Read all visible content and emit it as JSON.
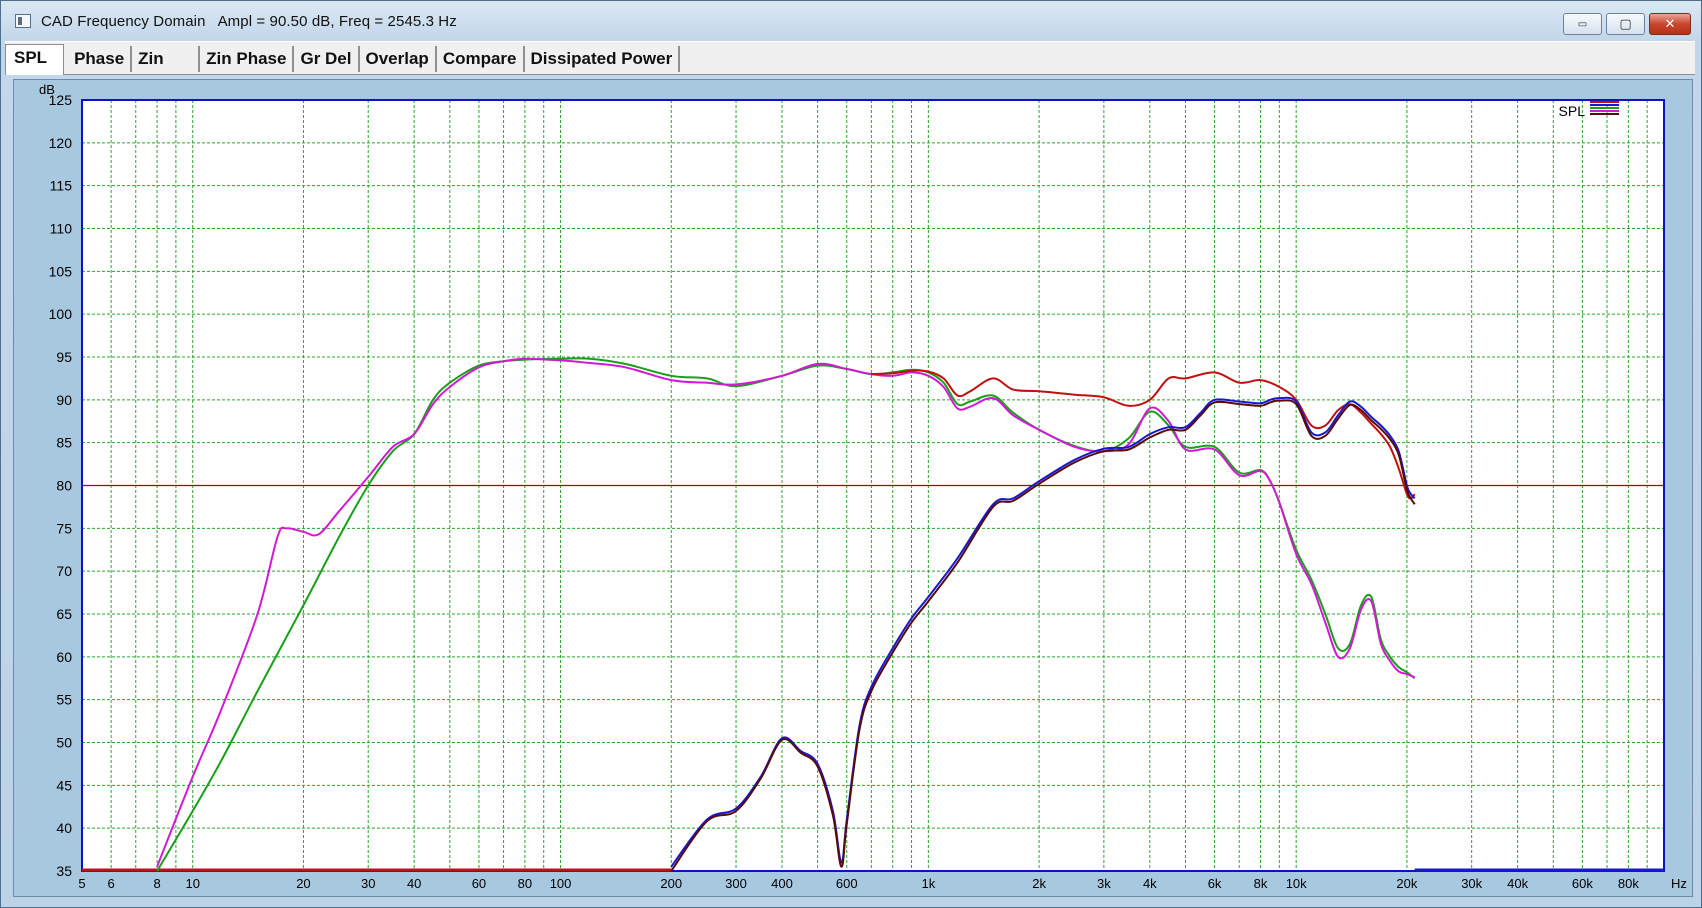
{
  "window": {
    "title": "CAD Frequency Domain",
    "readout": "Ampl = 90.50 dB, Freq = 2545.3 Hz",
    "buttons": {
      "minimize": "▭",
      "maximize": "▢",
      "close": "✕"
    }
  },
  "tabs": [
    "SPL",
    "Phase",
    "Zin",
    "Zin Phase",
    "Gr Del",
    "Overlap",
    "Compare",
    "Dissipated Power"
  ],
  "active_tab": "SPL",
  "colors": {
    "grid": "#2aa52a",
    "axis_frame": "#1010c8",
    "reference_line": "#b00000",
    "plot_background": "#ffffff",
    "series_green": "#18a018",
    "series_magenta": "#d21ad2",
    "series_red": "#c01010",
    "series_blue": "#1818d0",
    "series_dark": "#5a0a0a"
  },
  "chart_data": {
    "type": "line",
    "xscale": "log",
    "xlim": [
      5,
      100000
    ],
    "ylim": [
      35,
      125
    ],
    "ylabel": "dB",
    "xlabel": "Hz",
    "legend_label": "SPL",
    "legend_position": "top-right",
    "grid": true,
    "reference_line_y": 80,
    "yticks": [
      35,
      40,
      45,
      50,
      55,
      60,
      65,
      70,
      75,
      80,
      85,
      90,
      95,
      100,
      105,
      110,
      115,
      120,
      125
    ],
    "xtick_labels": [
      {
        "f": 5,
        "label": "5"
      },
      {
        "f": 6,
        "label": "6"
      },
      {
        "f": 8,
        "label": "8"
      },
      {
        "f": 10,
        "label": "10"
      },
      {
        "f": 20,
        "label": "20"
      },
      {
        "f": 30,
        "label": "30"
      },
      {
        "f": 40,
        "label": "40"
      },
      {
        "f": 60,
        "label": "60"
      },
      {
        "f": 80,
        "label": "80"
      },
      {
        "f": 100,
        "label": "100"
      },
      {
        "f": 200,
        "label": "200"
      },
      {
        "f": 300,
        "label": "300"
      },
      {
        "f": 400,
        "label": "400"
      },
      {
        "f": 600,
        "label": "600"
      },
      {
        "f": 1000,
        "label": "1k"
      },
      {
        "f": 2000,
        "label": "2k"
      },
      {
        "f": 3000,
        "label": "3k"
      },
      {
        "f": 4000,
        "label": "4k"
      },
      {
        "f": 6000,
        "label": "6k"
      },
      {
        "f": 8000,
        "label": "8k"
      },
      {
        "f": 10000,
        "label": "10k"
      },
      {
        "f": 20000,
        "label": "20k"
      },
      {
        "f": 30000,
        "label": "30k"
      },
      {
        "f": 40000,
        "label": "40k"
      },
      {
        "f": 60000,
        "label": "60k"
      },
      {
        "f": 80000,
        "label": "80k"
      }
    ],
    "series": [
      {
        "color_key": "series_green",
        "width": 2,
        "x": [
          8,
          10,
          12,
          15,
          20,
          25,
          30,
          35,
          40,
          45,
          50,
          60,
          70,
          80,
          100,
          120,
          150,
          200,
          250,
          300,
          400,
          500,
          600,
          700,
          800,
          900,
          1000,
          1100,
          1200,
          1300,
          1500,
          1700,
          2000,
          2500,
          3000,
          3500,
          4000,
          4500,
          5000,
          6000,
          7000,
          8000,
          8500,
          9000,
          10000,
          11000,
          12000,
          13000,
          14000,
          15000,
          16000,
          17000,
          18000,
          19000,
          20000,
          21000
        ],
        "y": [
          35,
          42,
          48,
          56,
          66,
          74,
          80,
          84,
          86,
          90,
          92,
          94,
          94.5,
          94.7,
          94.8,
          94.8,
          94.2,
          92.8,
          92.5,
          91.6,
          92.8,
          94,
          93.6,
          93,
          93.2,
          93.5,
          93.2,
          92,
          89.5,
          89.8,
          90.5,
          88.5,
          86.5,
          84.6,
          84,
          85.5,
          88.6,
          87,
          84.5,
          84.5,
          81.5,
          81.8,
          80.5,
          78,
          72.5,
          69,
          65,
          61,
          61.5,
          66,
          67,
          62,
          60,
          58.8,
          58.2,
          57.5
        ]
      },
      {
        "color_key": "series_magenta",
        "width": 2,
        "x": [
          8,
          10,
          12,
          15,
          17,
          18,
          20,
          22,
          25,
          30,
          35,
          40,
          45,
          50,
          60,
          70,
          80,
          100,
          120,
          150,
          200,
          250,
          300,
          400,
          500,
          600,
          700,
          800,
          900,
          1000,
          1100,
          1200,
          1300,
          1500,
          1700,
          2000,
          2500,
          3000,
          3500,
          4000,
          4500,
          5000,
          6000,
          7000,
          8000,
          8500,
          9000,
          10000,
          11000,
          12000,
          13000,
          14000,
          15000,
          16000,
          17000,
          18000,
          19000,
          20000,
          21000
        ],
        "y": [
          35.5,
          46,
          54,
          65,
          74,
          75,
          74.6,
          74.3,
          77,
          81,
          84.5,
          86,
          89.5,
          91.5,
          93.8,
          94.5,
          94.8,
          94.6,
          94.3,
          93.8,
          92.3,
          92,
          91.8,
          92.8,
          94.2,
          93.6,
          93,
          92.8,
          93.2,
          92.8,
          91.5,
          89,
          89.2,
          90.2,
          88.2,
          86.5,
          84.5,
          84,
          84.8,
          89,
          87.5,
          84.2,
          84.2,
          81.2,
          81.7,
          80.5,
          78,
          72,
          68.5,
          64,
          60,
          61,
          65.5,
          66.5,
          61.5,
          59.5,
          58.3,
          58,
          57.6
        ]
      },
      {
        "color_key": "series_red",
        "width": 2,
        "x": [
          700,
          800,
          900,
          1000,
          1100,
          1200,
          1300,
          1500,
          1700,
          2000,
          2500,
          3000,
          3500,
          4000,
          4500,
          5000,
          6000,
          7000,
          8000,
          9000,
          10000,
          11000,
          12000,
          13000,
          14000,
          15000,
          16000,
          17000,
          18000,
          19000,
          20000,
          20500,
          21000
        ],
        "y": [
          93,
          93.1,
          93.4,
          93.3,
          92.5,
          90.5,
          91,
          92.5,
          91.2,
          91,
          90.6,
          90.3,
          89.3,
          90,
          92.5,
          92.5,
          93.2,
          92,
          92.3,
          91.5,
          90,
          87,
          87,
          88.8,
          89.5,
          88.5,
          87.2,
          86,
          84.5,
          82,
          79,
          78.5,
          79
        ]
      },
      {
        "color_key": "series_blue",
        "width": 2,
        "x": [
          200,
          250,
          300,
          350,
          400,
          450,
          500,
          550,
          580,
          600,
          650,
          700,
          800,
          900,
          1000,
          1200,
          1500,
          1700,
          2000,
          2500,
          3000,
          3500,
          4000,
          4500,
          5000,
          5500,
          6000,
          7000,
          8000,
          8500,
          9000,
          10000,
          11000,
          12000,
          13000,
          14000,
          15000,
          16000,
          17000,
          18000,
          19000,
          20000,
          20500,
          21000
        ],
        "y": [
          35.5,
          41,
          42.3,
          46,
          50.5,
          49,
          47.5,
          42,
          36,
          41,
          52,
          56.5,
          61,
          64.5,
          67,
          71.5,
          77.8,
          78.5,
          80.5,
          83,
          84.3,
          84.5,
          86,
          86.8,
          86.8,
          88.5,
          90,
          89.8,
          89.6,
          90,
          90.2,
          89.8,
          86.2,
          86.2,
          88.2,
          89.8,
          89.2,
          88,
          87,
          85.8,
          84,
          80,
          79,
          78.5
        ]
      },
      {
        "color_key": "series_dark",
        "width": 2,
        "x": [
          200,
          250,
          300,
          350,
          400,
          450,
          500,
          550,
          580,
          600,
          650,
          700,
          800,
          900,
          1000,
          1200,
          1500,
          1700,
          2000,
          2500,
          3000,
          3500,
          4000,
          4500,
          5000,
          5500,
          6000,
          7000,
          8000,
          8500,
          9000,
          10000,
          11000,
          12000,
          13000,
          14000,
          15000,
          16000,
          17000,
          18000,
          19000,
          20000,
          20500,
          21000
        ],
        "y": [
          35,
          40.8,
          42,
          45.8,
          50.3,
          48.8,
          47.2,
          41.5,
          35.5,
          40.5,
          51.5,
          56,
          60.5,
          64,
          66.5,
          71,
          77.5,
          78.2,
          80.2,
          82.7,
          84,
          84.2,
          85.6,
          86.5,
          86.5,
          88.2,
          89.7,
          89.5,
          89.3,
          89.7,
          89.9,
          89.5,
          85.8,
          85.8,
          87.8,
          89.4,
          88.8,
          87.6,
          86.6,
          85.4,
          83.6,
          79.5,
          78.5,
          77.8
        ]
      }
    ],
    "floor_lines": [
      {
        "color_key": "series_red",
        "x": [
          5,
          200
        ],
        "y": [
          35,
          35
        ]
      },
      {
        "color_key": "series_blue",
        "x": [
          21000,
          100000
        ],
        "y": [
          35,
          35
        ]
      }
    ]
  }
}
